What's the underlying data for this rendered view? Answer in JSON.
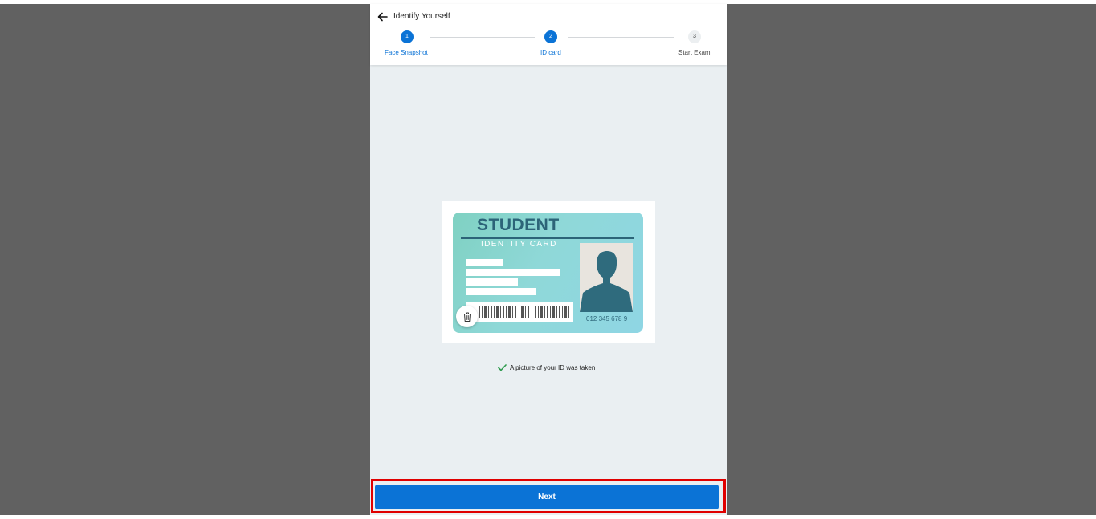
{
  "header": {
    "title": "Identify Yourself"
  },
  "steps": [
    {
      "number": "1",
      "label": "Face Snapshot",
      "state": "done"
    },
    {
      "number": "2",
      "label": "ID card",
      "state": "current"
    },
    {
      "number": "3",
      "label": "Start Exam",
      "state": "todo"
    }
  ],
  "id_card": {
    "title": "STUDENT",
    "subtitle": "IDENTITY CARD",
    "number": "012 345 678 9"
  },
  "status": {
    "message": "A picture of your ID was taken"
  },
  "footer": {
    "next_label": "Next"
  },
  "colors": {
    "accent": "#0b73d6",
    "highlight": "#e00000",
    "backdrop": "#616161",
    "success": "#2e9b4e"
  }
}
